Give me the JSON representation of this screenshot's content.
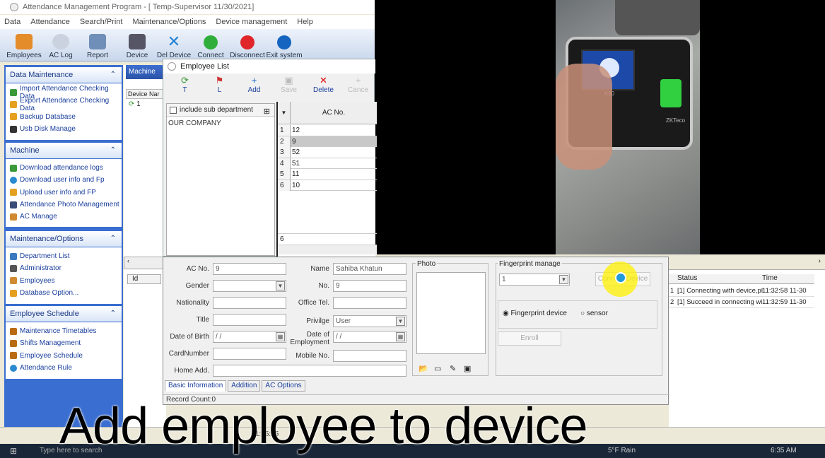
{
  "window": {
    "title": "Attendance Management Program - [ Temp-Supervisor 11/30/2021]"
  },
  "menu": [
    "Data",
    "Attendance",
    "Search/Print",
    "Maintenance/Options",
    "Device management",
    "Help"
  ],
  "toolbar": [
    "Employees",
    "AC Log",
    "Report",
    "Device",
    "Del Device",
    "Connect",
    "Disconnect",
    "Exit system"
  ],
  "sidebar": {
    "sections": [
      {
        "title": "Data Maintenance",
        "items": [
          "Import Attendance Checking Data",
          "Export Attendance Checking Data",
          "Backup Database",
          "Usb Disk Manage"
        ]
      },
      {
        "title": "Machine",
        "items": [
          "Download attendance logs",
          "Download user info and Fp",
          "Upload user info and FP",
          "Attendance Photo Management",
          "AC Manage"
        ]
      },
      {
        "title": "Maintenance/Options",
        "items": [
          "Department List",
          "Administrator",
          "Employees",
          "Database Option..."
        ]
      },
      {
        "title": "Employee Schedule",
        "items": [
          "Maintenance Timetables",
          "Shifts Management",
          "Employee Schedule",
          "Attendance Rule"
        ]
      }
    ]
  },
  "machine_panel": {
    "header": "Machine",
    "col_device": "Device Nar",
    "row1": "1",
    "id_col": "Id"
  },
  "employee_list": {
    "title": "Employee List",
    "tools": [
      "T",
      "L",
      "Add",
      "Save",
      "Delete",
      "Cance"
    ],
    "include_sub_department": "include sub department",
    "department": "OUR COMPANY",
    "grid_header": "AC No.",
    "rows": [
      {
        "n": "1",
        "v": "12"
      },
      {
        "n": "2",
        "v": "9"
      },
      {
        "n": "3",
        "v": "52"
      },
      {
        "n": "4",
        "v": "51"
      },
      {
        "n": "5",
        "v": "11"
      },
      {
        "n": "6",
        "v": "10"
      }
    ],
    "last_row_num": "6"
  },
  "employee_form": {
    "ac_no_label": "AC No.",
    "ac_no": "9",
    "name_label": "Name",
    "name": "Sahiba Khatun",
    "gender_label": "Gender",
    "gender": "",
    "no_label": "No.",
    "no": "9",
    "nationality_label": "Nationality",
    "office_tel_label": "Office Tel.",
    "title_label": "Title",
    "privilege_label": "Privilge",
    "privilege": "User",
    "dob_label": "Date of Birth",
    "dob": " / /",
    "doe_label": "Date of Employment",
    "doe": " / /",
    "card_label": "CardNumber",
    "mobile_label": "Mobile No.",
    "home_label": "Home Add.",
    "photo_label": "Photo",
    "fp_label": "Fingerprint manage",
    "fp_select": "1",
    "connect_device": "Connect Device",
    "fp_device": "Fingerprint device",
    "sensor": "sensor",
    "enroll": "Enroll",
    "tabs": [
      "Basic Information",
      "Addition",
      "AC Options"
    ],
    "record_count": "Record Count:0"
  },
  "log": {
    "col_status": "Status",
    "col_time": "Time",
    "rows": [
      {
        "n": "1",
        "status": "[1] Connecting with device,pl",
        "time": "11:32:58 11-30"
      },
      {
        "n": "2",
        "status": "[1] Succeed in connecting wi",
        "time": "11:32:59 11-30"
      }
    ]
  },
  "video": {
    "device_model": "K90",
    "brand": "ZKTeco"
  },
  "caption": "Add employee to device",
  "taskbar": {
    "search": "Type here to search",
    "weather": "5°F Rain",
    "clock": "6:35 AM",
    "statusbar_time": "11:35:05"
  }
}
